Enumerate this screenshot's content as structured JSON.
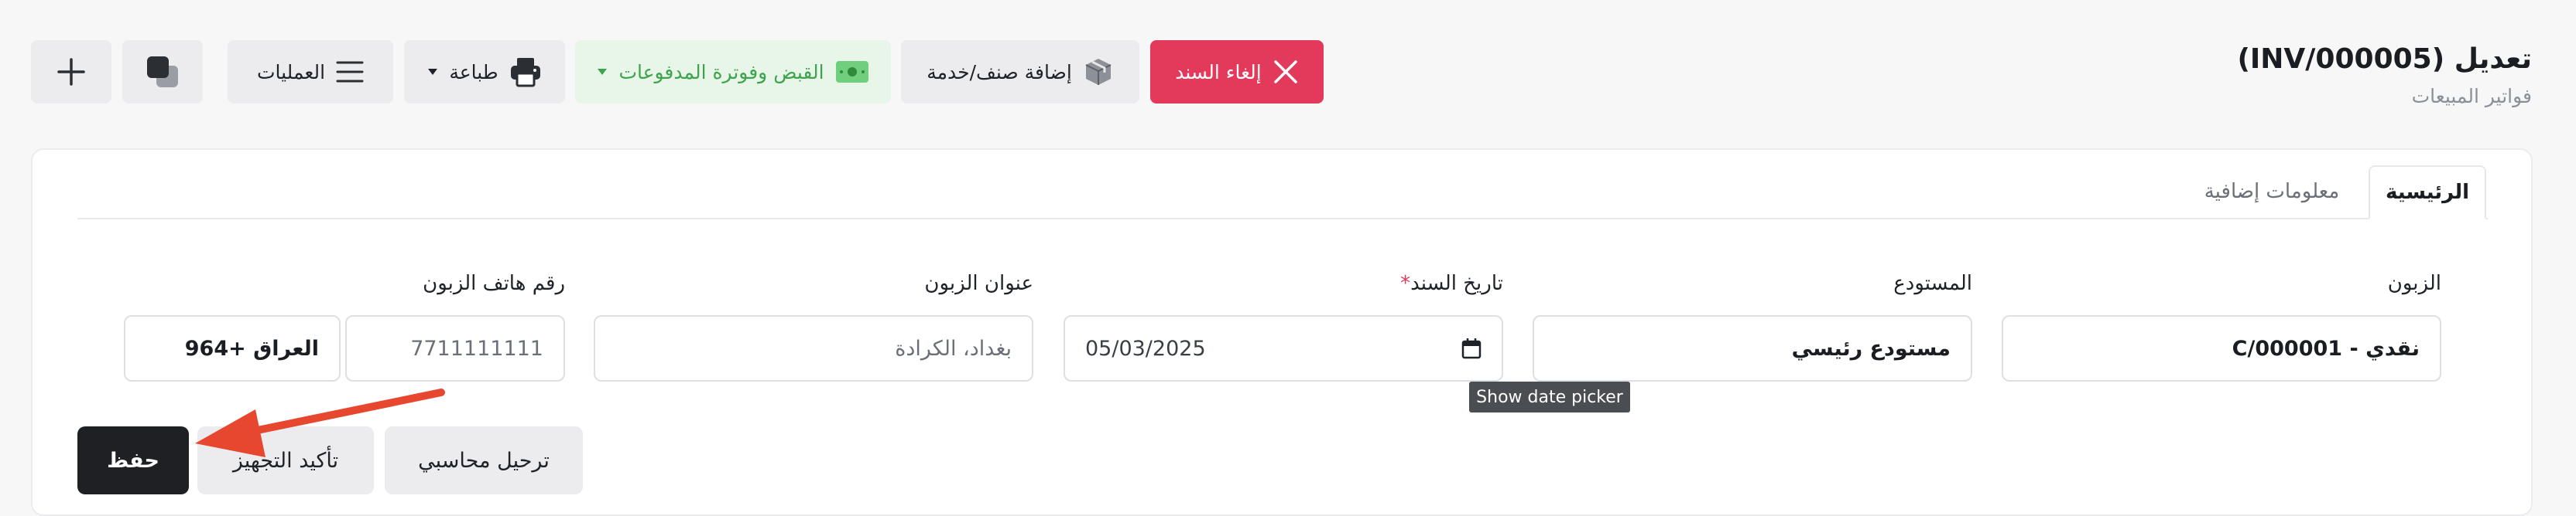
{
  "header": {
    "title": "تعديل (INV/000005)",
    "subtitle": "فواتير المبيعات"
  },
  "toolbar": {
    "cancel_label": "إلغاء السند",
    "add_item_label": "إضافة صنف/خدمة",
    "receipt_label": "القبض وفوترة المدفوعات",
    "print_label": "طباعة",
    "operations_label": "العمليات"
  },
  "tabs": [
    {
      "label": "الرئيسية",
      "active": true
    },
    {
      "label": "معلومات إضافية",
      "active": false
    }
  ],
  "form": {
    "customer": {
      "label": "الزبون",
      "value": "نقدي - C/000001"
    },
    "warehouse": {
      "label": "المستودع",
      "value": "مستودع رئيسي"
    },
    "date": {
      "label": "تاريخ السند",
      "required_mark": "*",
      "value": "05/03/2025"
    },
    "address": {
      "label": "عنوان الزبون",
      "value": "بغداد، الكرادة"
    },
    "phone": {
      "label": "رقم هاتف الزبون",
      "value": "7711111111",
      "country": "العراق +964"
    }
  },
  "tooltip": "Show date picker",
  "actions": {
    "post_label": "ترحيل محاسبي",
    "confirm_label": "تأكيد التجهيز",
    "save_label": "حفظ"
  },
  "colors": {
    "danger": "#e33a5b",
    "success_bg": "#e7f6e9",
    "success_text": "#3fa34d",
    "primary_dark": "#1f2023",
    "annotation_arrow": "#e8472f"
  },
  "icons": {
    "cancel": "close-icon",
    "add_item": "box-icon",
    "receipt": "cash-icon",
    "print": "printer-icon",
    "operations": "menu-icon",
    "copy": "copy-icon",
    "new": "plus-icon",
    "date": "calendar-icon"
  }
}
